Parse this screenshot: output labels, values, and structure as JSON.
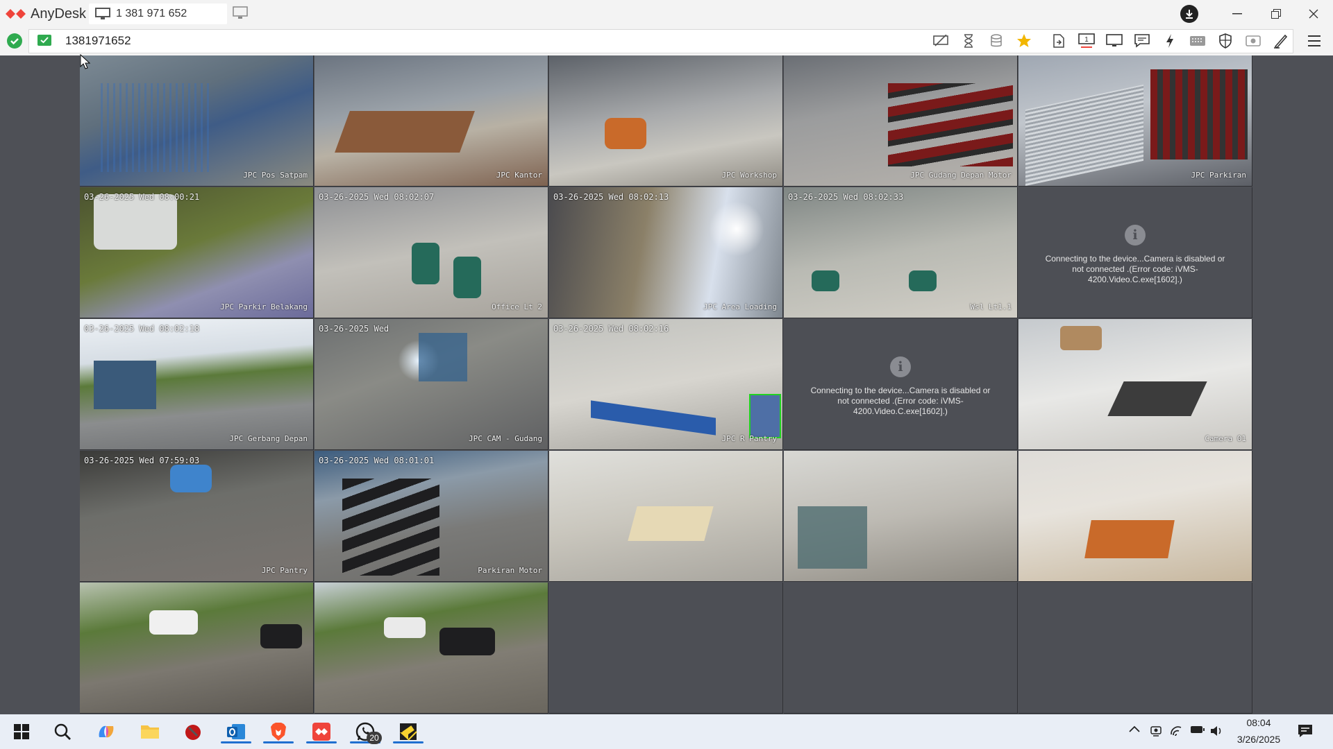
{
  "app": {
    "name": "AnyDesk",
    "brand_color": "#ef443b"
  },
  "session_tab": {
    "label": "1 381 971 652",
    "icon": "monitor-icon"
  },
  "address": {
    "value": "1381971652",
    "status": "connected"
  },
  "toolbar": {
    "icons": [
      "privacy-icon",
      "hourglass-icon",
      "database-icon",
      "favorite-star-icon",
      "file-transfer-icon",
      "display-1-icon",
      "display-icon",
      "chat-icon",
      "actions-lightning-icon",
      "keyboard-icon",
      "permissions-shield-icon",
      "screenshot-icon",
      "whiteboard-pen-icon",
      "menu-icon"
    ]
  },
  "cameras": [
    {
      "stamp": "",
      "label": "JPC Pos Satpam"
    },
    {
      "stamp": "",
      "label": "JPC Kantor"
    },
    {
      "stamp": "",
      "label": "JPC Workshop"
    },
    {
      "stamp": "",
      "label": "JPC Gudang Depan Motor"
    },
    {
      "stamp": "",
      "label": "JPC Parkiran"
    },
    {
      "stamp": "03-26-2025 Wed 08:00:21",
      "label": "JPC Parkir Belakang"
    },
    {
      "stamp": "03-26-2025 Wed 08:02:07",
      "label": "Office Lt 2"
    },
    {
      "stamp": "03-26-2025 Wed 08:02:13",
      "label": "JPC Area Loading"
    },
    {
      "stamp": "03-26-2025 Wed 08:02:33",
      "label": "Wsl Lt1.1"
    },
    {
      "stamp": "",
      "label": ""
    },
    {
      "stamp": "03-26-2025 Wed 08:02:18",
      "label": "JPC Gerbang Depan"
    },
    {
      "stamp": "03-26-2025 Wed",
      "label": "JPC CAM - Gudang"
    },
    {
      "stamp": "03-26-2025 Wed 08:02:16",
      "label": "JPC R Pantry"
    },
    {
      "stamp": "",
      "label": ""
    },
    {
      "stamp": "",
      "label": "Camera 01"
    },
    {
      "stamp": "03-26-2025 Wed 07:59:03",
      "label": "JPC Pantry"
    },
    {
      "stamp": "03-26-2025 Wed 08:01:01",
      "label": "Parkiran Motor"
    },
    {
      "stamp": "",
      "label": ""
    },
    {
      "stamp": "",
      "label": ""
    },
    {
      "stamp": "",
      "label": ""
    },
    {
      "stamp": "",
      "label": ""
    },
    {
      "stamp": "",
      "label": ""
    }
  ],
  "error_message": "Connecting to the device...Camera is disabled or not connected .(Error code: iVMS-4200.Video.C.exe[1602].)",
  "taskbar": {
    "apps": [
      "windows-start-icon",
      "search-icon",
      "copilot-icon",
      "file-explorer-icon",
      "app-red-icon",
      "outlook-icon",
      "brave-icon",
      "anydesk-icon",
      "whatsapp-icon",
      "sticky-notes-icon"
    ],
    "whatsapp_badge": "20",
    "time": "08:04",
    "date": "3/26/2025"
  }
}
